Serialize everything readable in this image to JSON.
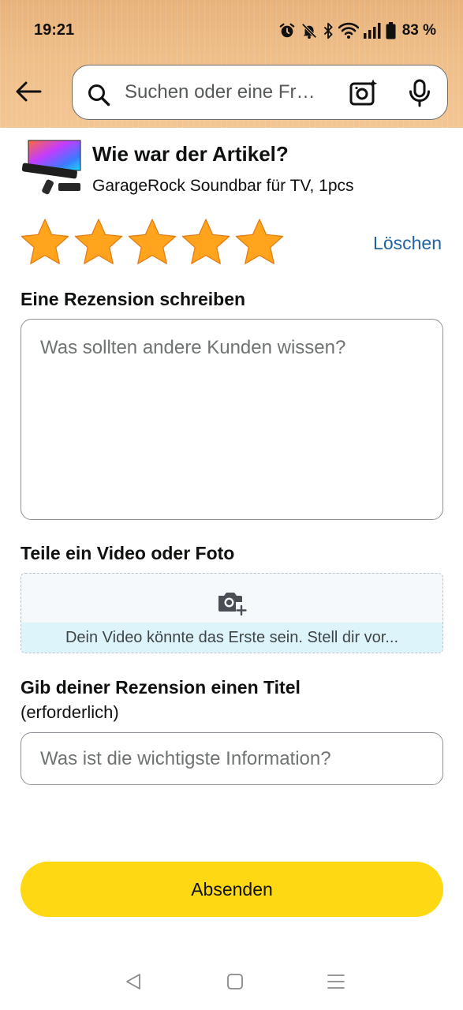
{
  "status_bar": {
    "time": "19:21",
    "battery": "83 %",
    "icons": [
      "alarm-icon",
      "bell-off-icon",
      "bluetooth-icon",
      "wifi-icon",
      "signal-icon",
      "battery-icon"
    ]
  },
  "search": {
    "placeholder": "Suchen oder eine Fr…",
    "value": ""
  },
  "product": {
    "heading": "Wie war der Artikel?",
    "name": "GarageRock Soundbar für TV, 1pcs"
  },
  "rating": {
    "stars": 5,
    "max": 5,
    "clear_label": "Löschen",
    "star_color": "#ffa41c"
  },
  "review": {
    "label": "Eine Rezension schreiben",
    "placeholder": "Was sollten andere Kunden wissen?",
    "value": ""
  },
  "media": {
    "label": "Teile ein Video oder Foto",
    "caption": "Dein Video könnte das Erste sein. Stell dir vor..."
  },
  "title": {
    "label": "Gib deiner Rezension einen Titel",
    "required": "(erforderlich)",
    "placeholder": "Was ist die wichtigste Information?",
    "value": ""
  },
  "submit": {
    "label": "Absenden",
    "color": "#ffd814"
  },
  "colors": {
    "link": "#2162a1",
    "header": "#efbf8a"
  }
}
